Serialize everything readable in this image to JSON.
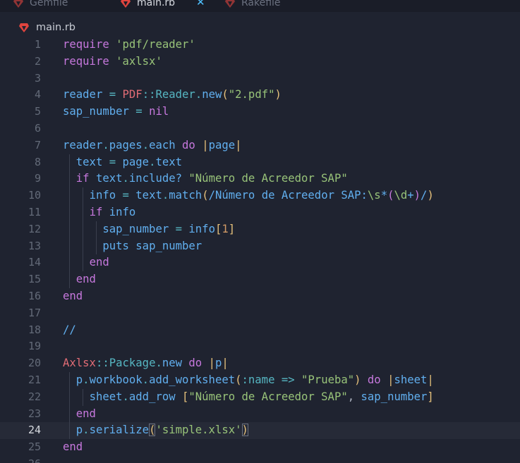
{
  "tabs": [
    {
      "label": "Gemfile",
      "active": false
    },
    {
      "label": "main.rb",
      "active": true
    },
    {
      "label": "Rakefile",
      "active": false
    }
  ],
  "close_glyph": "✕",
  "breadcrumb": {
    "file": "main.rb"
  },
  "icons": {
    "ruby": "ruby-icon",
    "close": "close-icon"
  },
  "colors": {
    "background": "#1f2330",
    "current_line": "#262a37",
    "keyword": "#c678dd",
    "variable": "#61afef",
    "string": "#98c379",
    "constant": "#e06c75",
    "operator": "#56b6c2",
    "bracket": "#e5c07b",
    "ruby_icon": "#e0443e"
  },
  "editor": {
    "current_line": 24,
    "lines": [
      {
        "n": "1",
        "tokens": [
          [
            "kw",
            "require"
          ],
          [
            "pun",
            " "
          ],
          [
            "str",
            "'pdf/reader'"
          ]
        ]
      },
      {
        "n": "2",
        "tokens": [
          [
            "kw",
            "require"
          ],
          [
            "pun",
            " "
          ],
          [
            "str",
            "'axlsx'"
          ]
        ]
      },
      {
        "n": "3",
        "tokens": []
      },
      {
        "n": "4",
        "tokens": [
          [
            "var",
            "reader"
          ],
          [
            "pun",
            " "
          ],
          [
            "op",
            "="
          ],
          [
            "pun",
            " "
          ],
          [
            "const",
            "PDF"
          ],
          [
            "op",
            "::"
          ],
          [
            "cls",
            "Reader"
          ],
          [
            "op",
            "."
          ],
          [
            "fn",
            "new"
          ],
          [
            "br1",
            "("
          ],
          [
            "str",
            "\"2.pdf\""
          ],
          [
            "br1",
            ")"
          ]
        ]
      },
      {
        "n": "5",
        "tokens": [
          [
            "var",
            "sap_number"
          ],
          [
            "pun",
            " "
          ],
          [
            "op",
            "="
          ],
          [
            "pun",
            " "
          ],
          [
            "kw",
            "nil"
          ]
        ]
      },
      {
        "n": "6",
        "tokens": []
      },
      {
        "n": "7",
        "tokens": [
          [
            "var",
            "reader"
          ],
          [
            "op",
            "."
          ],
          [
            "var",
            "pages"
          ],
          [
            "op",
            "."
          ],
          [
            "var",
            "each"
          ],
          [
            "pun",
            " "
          ],
          [
            "kw",
            "do"
          ],
          [
            "pun",
            " "
          ],
          [
            "bar",
            "|"
          ],
          [
            "var",
            "page"
          ],
          [
            "bar",
            "|"
          ]
        ]
      },
      {
        "n": "8",
        "tokens": [
          [
            "pun",
            "  "
          ],
          [
            "var",
            "text"
          ],
          [
            "pun",
            " "
          ],
          [
            "op",
            "="
          ],
          [
            "pun",
            " "
          ],
          [
            "var",
            "page"
          ],
          [
            "op",
            "."
          ],
          [
            "var",
            "text"
          ]
        ]
      },
      {
        "n": "9",
        "tokens": [
          [
            "pun",
            "  "
          ],
          [
            "kw",
            "if"
          ],
          [
            "pun",
            " "
          ],
          [
            "var",
            "text"
          ],
          [
            "op",
            "."
          ],
          [
            "var",
            "include?"
          ],
          [
            "pun",
            " "
          ],
          [
            "str",
            "\"Número de Acreedor SAP\""
          ]
        ]
      },
      {
        "n": "10",
        "tokens": [
          [
            "pun",
            "    "
          ],
          [
            "var",
            "info"
          ],
          [
            "pun",
            " "
          ],
          [
            "op",
            "="
          ],
          [
            "pun",
            " "
          ],
          [
            "var",
            "text"
          ],
          [
            "op",
            "."
          ],
          [
            "var",
            "match"
          ],
          [
            "br1",
            "("
          ],
          [
            "re",
            "/Número de Acreedor SAP:"
          ],
          [
            "esc",
            "\\s"
          ],
          [
            "re",
            "*"
          ],
          [
            "br2",
            "("
          ],
          [
            "esc",
            "\\d"
          ],
          [
            "re",
            "+"
          ],
          [
            "br2",
            ")"
          ],
          [
            "re",
            "/"
          ],
          [
            "br1",
            ")"
          ]
        ]
      },
      {
        "n": "11",
        "tokens": [
          [
            "pun",
            "    "
          ],
          [
            "kw",
            "if"
          ],
          [
            "pun",
            " "
          ],
          [
            "var",
            "info"
          ]
        ]
      },
      {
        "n": "12",
        "tokens": [
          [
            "pun",
            "      "
          ],
          [
            "var",
            "sap_number"
          ],
          [
            "pun",
            " "
          ],
          [
            "op",
            "="
          ],
          [
            "pun",
            " "
          ],
          [
            "var",
            "info"
          ],
          [
            "br1",
            "["
          ],
          [
            "num",
            "1"
          ],
          [
            "br1",
            "]"
          ]
        ]
      },
      {
        "n": "13",
        "tokens": [
          [
            "pun",
            "      "
          ],
          [
            "var",
            "puts"
          ],
          [
            "pun",
            " "
          ],
          [
            "var",
            "sap_number"
          ]
        ]
      },
      {
        "n": "14",
        "tokens": [
          [
            "pun",
            "    "
          ],
          [
            "kw",
            "end"
          ]
        ]
      },
      {
        "n": "15",
        "tokens": [
          [
            "pun",
            "  "
          ],
          [
            "kw",
            "end"
          ]
        ]
      },
      {
        "n": "16",
        "tokens": [
          [
            "kw",
            "end"
          ]
        ]
      },
      {
        "n": "17",
        "tokens": []
      },
      {
        "n": "18",
        "tokens": [
          [
            "var",
            "//"
          ]
        ]
      },
      {
        "n": "19",
        "tokens": []
      },
      {
        "n": "20",
        "tokens": [
          [
            "const",
            "Axlsx"
          ],
          [
            "op",
            "::"
          ],
          [
            "cls",
            "Package"
          ],
          [
            "op",
            "."
          ],
          [
            "fn",
            "new"
          ],
          [
            "pun",
            " "
          ],
          [
            "kw",
            "do"
          ],
          [
            "pun",
            " "
          ],
          [
            "bar",
            "|"
          ],
          [
            "var",
            "p"
          ],
          [
            "bar",
            "|"
          ]
        ]
      },
      {
        "n": "21",
        "tokens": [
          [
            "pun",
            "  "
          ],
          [
            "var",
            "p"
          ],
          [
            "op",
            "."
          ],
          [
            "var",
            "workbook"
          ],
          [
            "op",
            "."
          ],
          [
            "var",
            "add_worksheet"
          ],
          [
            "br1",
            "("
          ],
          [
            "sym",
            ":name"
          ],
          [
            "pun",
            " "
          ],
          [
            "op",
            "=>"
          ],
          [
            "pun",
            " "
          ],
          [
            "str",
            "\"Prueba\""
          ],
          [
            "br1",
            ")"
          ],
          [
            "pun",
            " "
          ],
          [
            "kw",
            "do"
          ],
          [
            "pun",
            " "
          ],
          [
            "bar",
            "|"
          ],
          [
            "var",
            "sheet"
          ],
          [
            "bar",
            "|"
          ]
        ]
      },
      {
        "n": "22",
        "tokens": [
          [
            "pun",
            "    "
          ],
          [
            "var",
            "sheet"
          ],
          [
            "op",
            "."
          ],
          [
            "var",
            "add_row"
          ],
          [
            "pun",
            " "
          ],
          [
            "br1",
            "["
          ],
          [
            "str",
            "\"Número de Acreedor SAP\""
          ],
          [
            "pun",
            ", "
          ],
          [
            "var",
            "sap_number"
          ],
          [
            "br1",
            "]"
          ]
        ]
      },
      {
        "n": "23",
        "tokens": [
          [
            "pun",
            "  "
          ],
          [
            "kw",
            "end"
          ]
        ]
      },
      {
        "n": "24",
        "tokens": [
          [
            "pun",
            "  "
          ],
          [
            "var",
            "p"
          ],
          [
            "op",
            "."
          ],
          [
            "var",
            "serialize"
          ],
          [
            "br1",
            "("
          ],
          [
            "str",
            "'simple.xlsx'"
          ],
          [
            "br1",
            ")"
          ]
        ]
      },
      {
        "n": "25",
        "tokens": [
          [
            "kw",
            "end"
          ]
        ]
      },
      {
        "n": "26",
        "tokens": []
      }
    ]
  }
}
